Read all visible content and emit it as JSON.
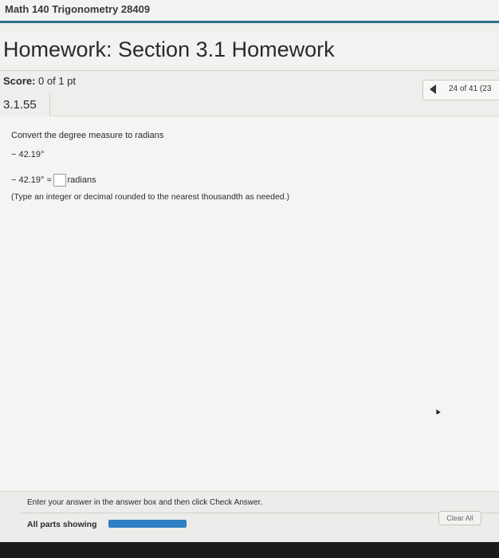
{
  "course": {
    "title": "Math 140 Trigonometry 28409"
  },
  "header": {
    "title": "Homework: Section 3.1 Homework"
  },
  "score": {
    "label": "Score:",
    "value": "0 of 1 pt"
  },
  "nav": {
    "count": "24 of 41 (23"
  },
  "question": {
    "id": "3.1.55",
    "instruction": "Convert the degree measure to radians",
    "given": "− 42.19°",
    "answer_prefix": "− 42.19° ≈",
    "answer_value": "",
    "answer_unit": "radians",
    "hint": "(Type an integer or decimal rounded to the nearest thousandth as needed.)"
  },
  "footer": {
    "message": "Enter your answer in the answer box and then click Check Answer.",
    "parts_label": "All parts showing",
    "clear_label": "Clear All"
  },
  "colors": {
    "accent": "#2f6f8f",
    "progress": "#2f7fc4"
  }
}
